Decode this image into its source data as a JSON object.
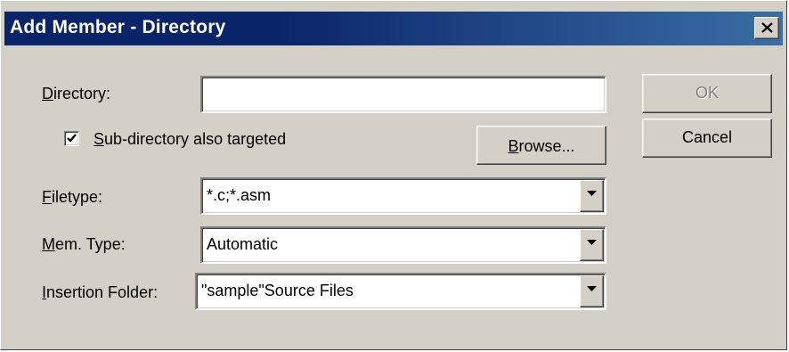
{
  "window": {
    "title": "Add Member - Directory"
  },
  "form": {
    "directory": {
      "label_mnemonic": "D",
      "label_rest": "irectory:",
      "value": ""
    },
    "subdir_checkbox": {
      "label_mnemonic": "S",
      "label_rest": "ub-directory also targeted",
      "checked": true
    },
    "filetype": {
      "label_mnemonic": "F",
      "label_rest": "iletype:",
      "value": "*.c;*.asm"
    },
    "mem_type": {
      "label_mnemonic": "M",
      "label_rest": "em. Type:",
      "value": "Automatic"
    },
    "insertion_folder": {
      "label_mnemonic": "I",
      "label_rest": "nsertion Folder:",
      "value": "\"sample\"Source Files"
    }
  },
  "buttons": {
    "ok": "OK",
    "cancel": "Cancel",
    "browse_mnemonic": "B",
    "browse_rest": "rowse..."
  },
  "icons": {
    "close": "close-icon",
    "checkmark": "checkmark-icon",
    "dropdown": "chevron-down-icon"
  },
  "colors": {
    "titlebar_start": "#0a246a",
    "titlebar_end": "#3a6ea5",
    "dialog_face": "#d4d0c8"
  }
}
